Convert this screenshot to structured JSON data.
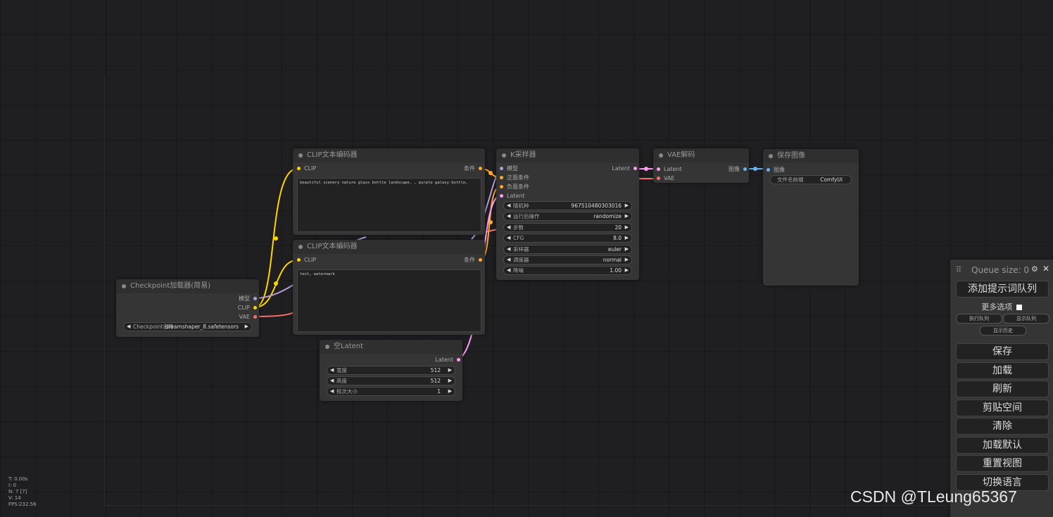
{
  "colors": {
    "clip": "#ffd500",
    "model": "#b39ddb",
    "vae": "#ff6e6e",
    "conditioning": "#ffa931",
    "latent": "#ff9cf9",
    "image": "#64b5f6"
  },
  "nodes": {
    "clip_pos": {
      "title": "CLIP文本编码器",
      "in_clip": "CLIP",
      "out_cond": "条件",
      "text": "beautiful scenery nature glass bottle landscape, , purple galaxy bottle,"
    },
    "clip_neg": {
      "title": "CLIP文本编码器",
      "in_clip": "CLIP",
      "out_cond": "条件",
      "text": "text, watermark"
    },
    "ksampler": {
      "title": "K采样器",
      "in_model": "模型",
      "in_pos": "正面条件",
      "in_neg": "负面条件",
      "in_latent": "Latent",
      "out_latent": "Latent",
      "widgets": [
        {
          "label": "随机种",
          "value": "967510480303016"
        },
        {
          "label": "运行后操作",
          "value": "randomize"
        },
        {
          "label": "步数",
          "value": "20"
        },
        {
          "label": "CFG",
          "value": "8.0"
        },
        {
          "label": "采样器",
          "value": "euler"
        },
        {
          "label": "调度器",
          "value": "normal"
        },
        {
          "label": "降噪",
          "value": "1.00"
        }
      ]
    },
    "vae_decode": {
      "title": "VAE解码",
      "in_latent": "Latent",
      "in_vae": "VAE",
      "out_image": "图像"
    },
    "save_image": {
      "title": "保存图像",
      "in_image": "图像",
      "widget_label": "文件名前缀",
      "widget_value": "ComfyUI"
    },
    "checkpoint": {
      "title": "Checkpoint加载器(简易)",
      "out_model": "模型",
      "out_clip": "CLIP",
      "out_vae": "VAE",
      "widget_label": "Checkpoint名称",
      "widget_value": "dreamshaper_8.safetensors"
    },
    "empty_latent": {
      "title": "空Latent",
      "out_latent": "Latent",
      "widgets": [
        {
          "label": "宽度",
          "value": "512"
        },
        {
          "label": "高度",
          "value": "512"
        },
        {
          "label": "批次大小",
          "value": "1"
        }
      ]
    }
  },
  "queue": {
    "title": "Queue size: 0",
    "queue_prompt": "添加提示词队列",
    "more_options": "更多选项",
    "run_queue": "执行队列",
    "view_queue": "显示队列",
    "view_history": "显示历史",
    "buttons": [
      "保存",
      "加载",
      "刷新",
      "剪贴空间",
      "清除",
      "加载默认",
      "重置视图",
      "切换语言"
    ]
  },
  "stats": {
    "t": "T: 0.00s",
    "i": "I: 0",
    "n": "N: 7 [7]",
    "v": "V: 14",
    "fps": "FPS:232.56"
  },
  "watermark": "CSDN @TLeung65367"
}
